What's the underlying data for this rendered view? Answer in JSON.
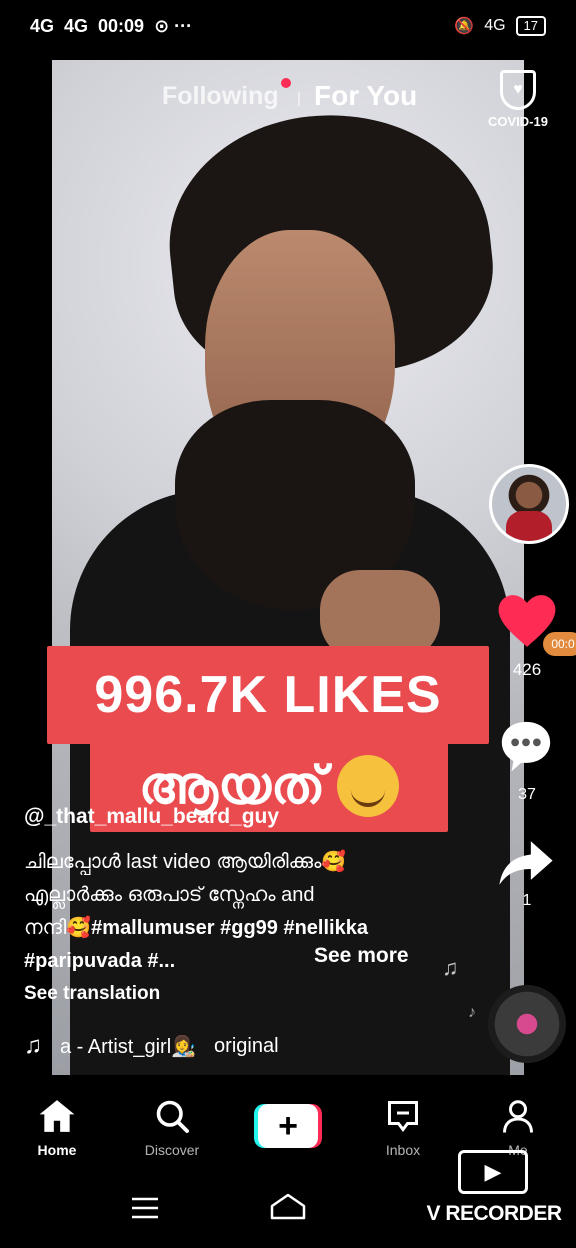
{
  "status_bar": {
    "signal1": "4G",
    "signal2": "4G",
    "time": "00:09",
    "extras": "⊙ ···",
    "right_net": "4G",
    "battery": "17"
  },
  "top_nav": {
    "following": "Following",
    "for_you": "For You",
    "covid_label": "COVID-19"
  },
  "video": {
    "likes_banner": "996.7K LIKES",
    "banner_line2": "ആയത്"
  },
  "rail": {
    "like_count": "426",
    "comment_count": "37",
    "share_count": "1",
    "timer_badge": "00:0"
  },
  "caption": {
    "username": "@_that_mallu_beard_guy",
    "line1": "ചിലപ്പോൾ last video ആയിരിക്കും🥰",
    "line2": "എല്ലാർക്കും ഒരുപാട് സ്നേഹം and",
    "line3_prefix": "നന്ദി🥰",
    "line3_tags": "#mallumuser #gg99 #nellikka",
    "line4": "#paripuvada #...",
    "see_more": "See more",
    "see_translation": "See translation",
    "sound_text": "a - Artist_girl👩‍🎨",
    "sound_original": "original"
  },
  "bottom_nav": {
    "home": "Home",
    "discover": "Discover",
    "inbox": "Inbox",
    "me": "Me"
  },
  "recorder": {
    "label": "V RECORDER"
  },
  "colors": {
    "accent": "#fe2c55",
    "cyan": "#25f4ee",
    "banner": "#e94b4f"
  }
}
